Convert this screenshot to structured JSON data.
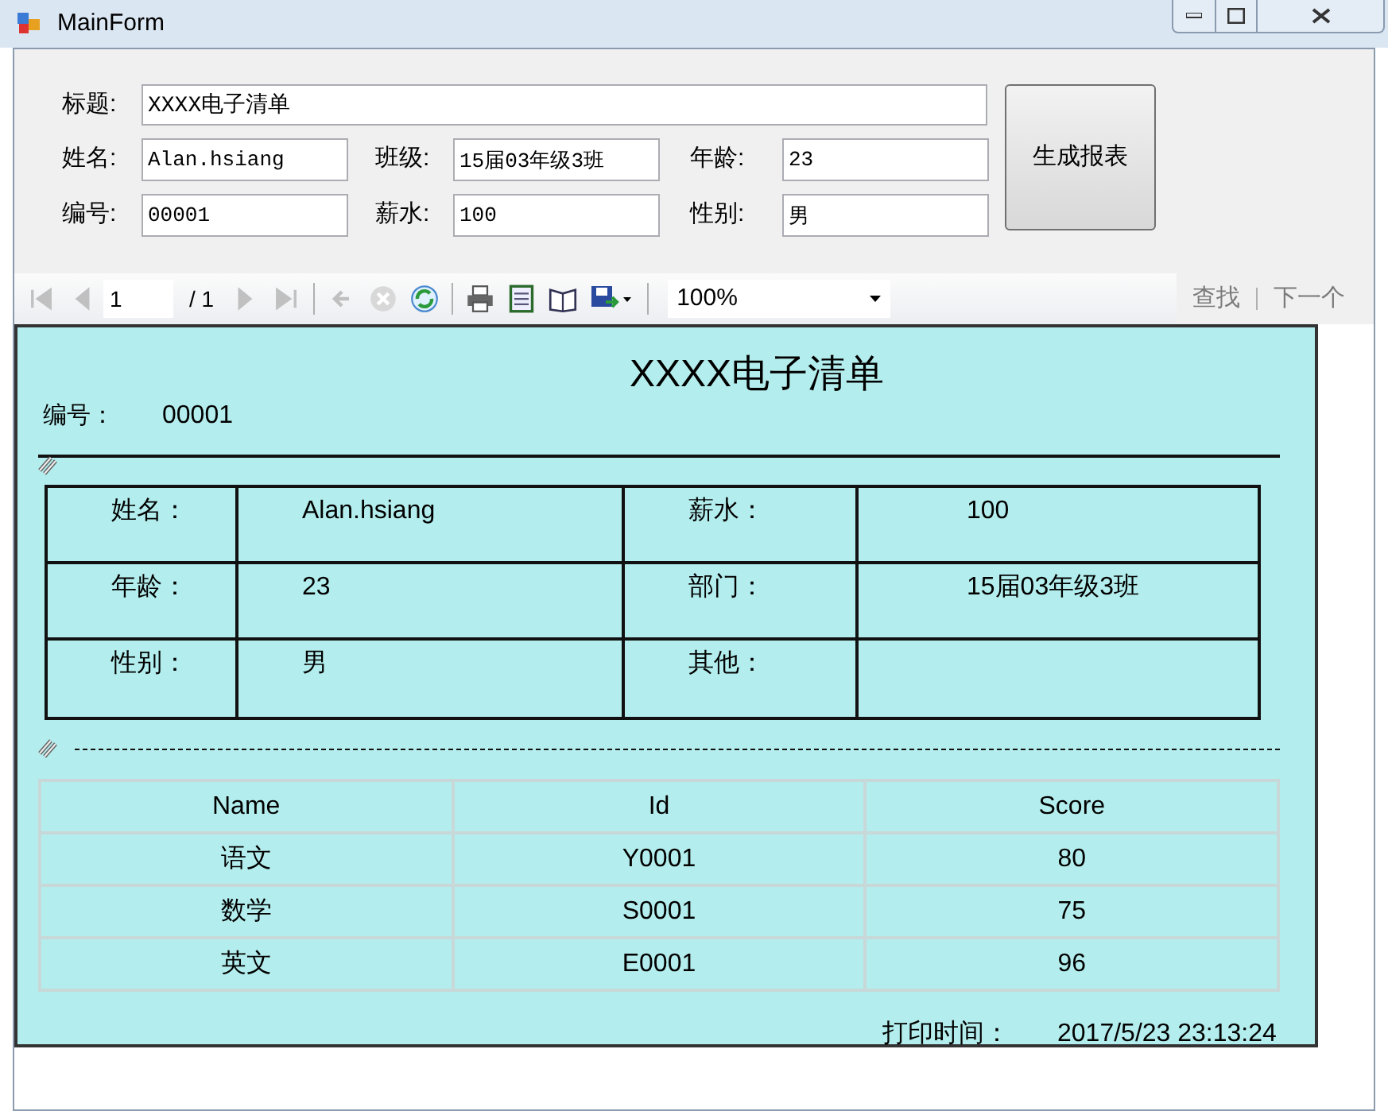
{
  "window": {
    "title": "MainForm"
  },
  "form": {
    "title_field": {
      "label": "标题:",
      "value": "XXXX电子清单"
    },
    "rows": [
      [
        {
          "label": "姓名:",
          "value": "Alan.hsiang"
        },
        {
          "label": "班级:",
          "value": "15届03年级3班"
        },
        {
          "label": "年龄:",
          "value": "23"
        }
      ],
      [
        {
          "label": "编号:",
          "value": "00001"
        },
        {
          "label": "薪水:",
          "value": "100"
        },
        {
          "label": "性别:",
          "value": "男"
        }
      ]
    ],
    "button": "生成报表"
  },
  "toolbar": {
    "page": "1",
    "page_total": "/ 1",
    "zoom": "100%",
    "find": "查找",
    "find_next": "下一个",
    "buttons": [
      {
        "kind": "first",
        "disabled": true
      },
      {
        "kind": "prev",
        "disabled": true
      },
      {
        "kind": "page"
      },
      {
        "kind": "next",
        "disabled": true
      },
      {
        "kind": "last",
        "disabled": true
      },
      {
        "kind": "sep"
      },
      {
        "kind": "back",
        "disabled": true
      },
      {
        "kind": "stop",
        "disabled": true
      },
      {
        "kind": "refresh",
        "disabled": false
      },
      {
        "kind": "sep"
      },
      {
        "kind": "print",
        "disabled": false
      },
      {
        "kind": "layout",
        "disabled": false
      },
      {
        "kind": "setup",
        "disabled": false
      },
      {
        "kind": "export",
        "disabled": false
      },
      {
        "kind": "sep"
      },
      {
        "kind": "zoom"
      }
    ]
  },
  "report": {
    "title": "XXXX电子清单",
    "number_label": "编号：",
    "number_value": "00001",
    "info_rows": [
      [
        "姓名：",
        "Alan.hsiang",
        "薪水：",
        "100"
      ],
      [
        "年龄：",
        "23",
        "部门：",
        "15届03年级3班"
      ],
      [
        "性别：",
        "男",
        "其他：",
        ""
      ]
    ],
    "score_table": {
      "columns": [
        "Name",
        "Id",
        "Score"
      ],
      "rows": [
        [
          "语文",
          "Y0001",
          "80"
        ],
        [
          "数学",
          "S0001",
          "75"
        ],
        [
          "英文",
          "E0001",
          "96"
        ]
      ]
    },
    "print_label": "打印时间：",
    "print_value": "2017/5/23 23:13:24"
  }
}
